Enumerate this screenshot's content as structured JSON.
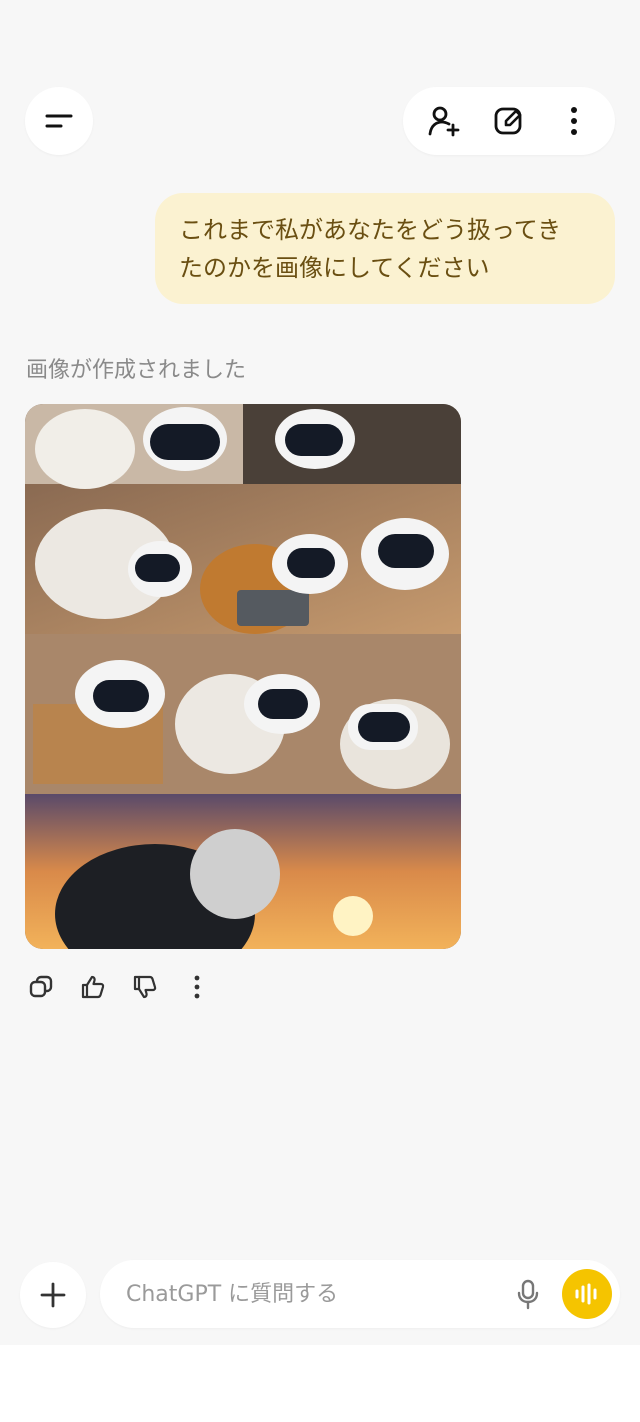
{
  "header": {
    "menu_icon": "menu-icon",
    "add_person_icon": "add-person-icon",
    "new_chat_icon": "edit-icon",
    "more_icon": "more-vertical-icon"
  },
  "conversation": {
    "user_message_line1": "これまで私があなたをどう扱ってき",
    "user_message_line2": "たのかを画像にしてください",
    "status_text": "画像が作成されました",
    "image_alt": "画像"
  },
  "message_actions": [
    "copy-icon",
    "thumbs-up-icon",
    "thumbs-down-icon",
    "more-icon"
  ],
  "composer": {
    "placeholder": "ChatGPT に質問する",
    "value": ""
  },
  "colors": {
    "accent": "#f5c400",
    "bubble": "#fbf2d1",
    "bubble_text": "#6a4f12"
  }
}
